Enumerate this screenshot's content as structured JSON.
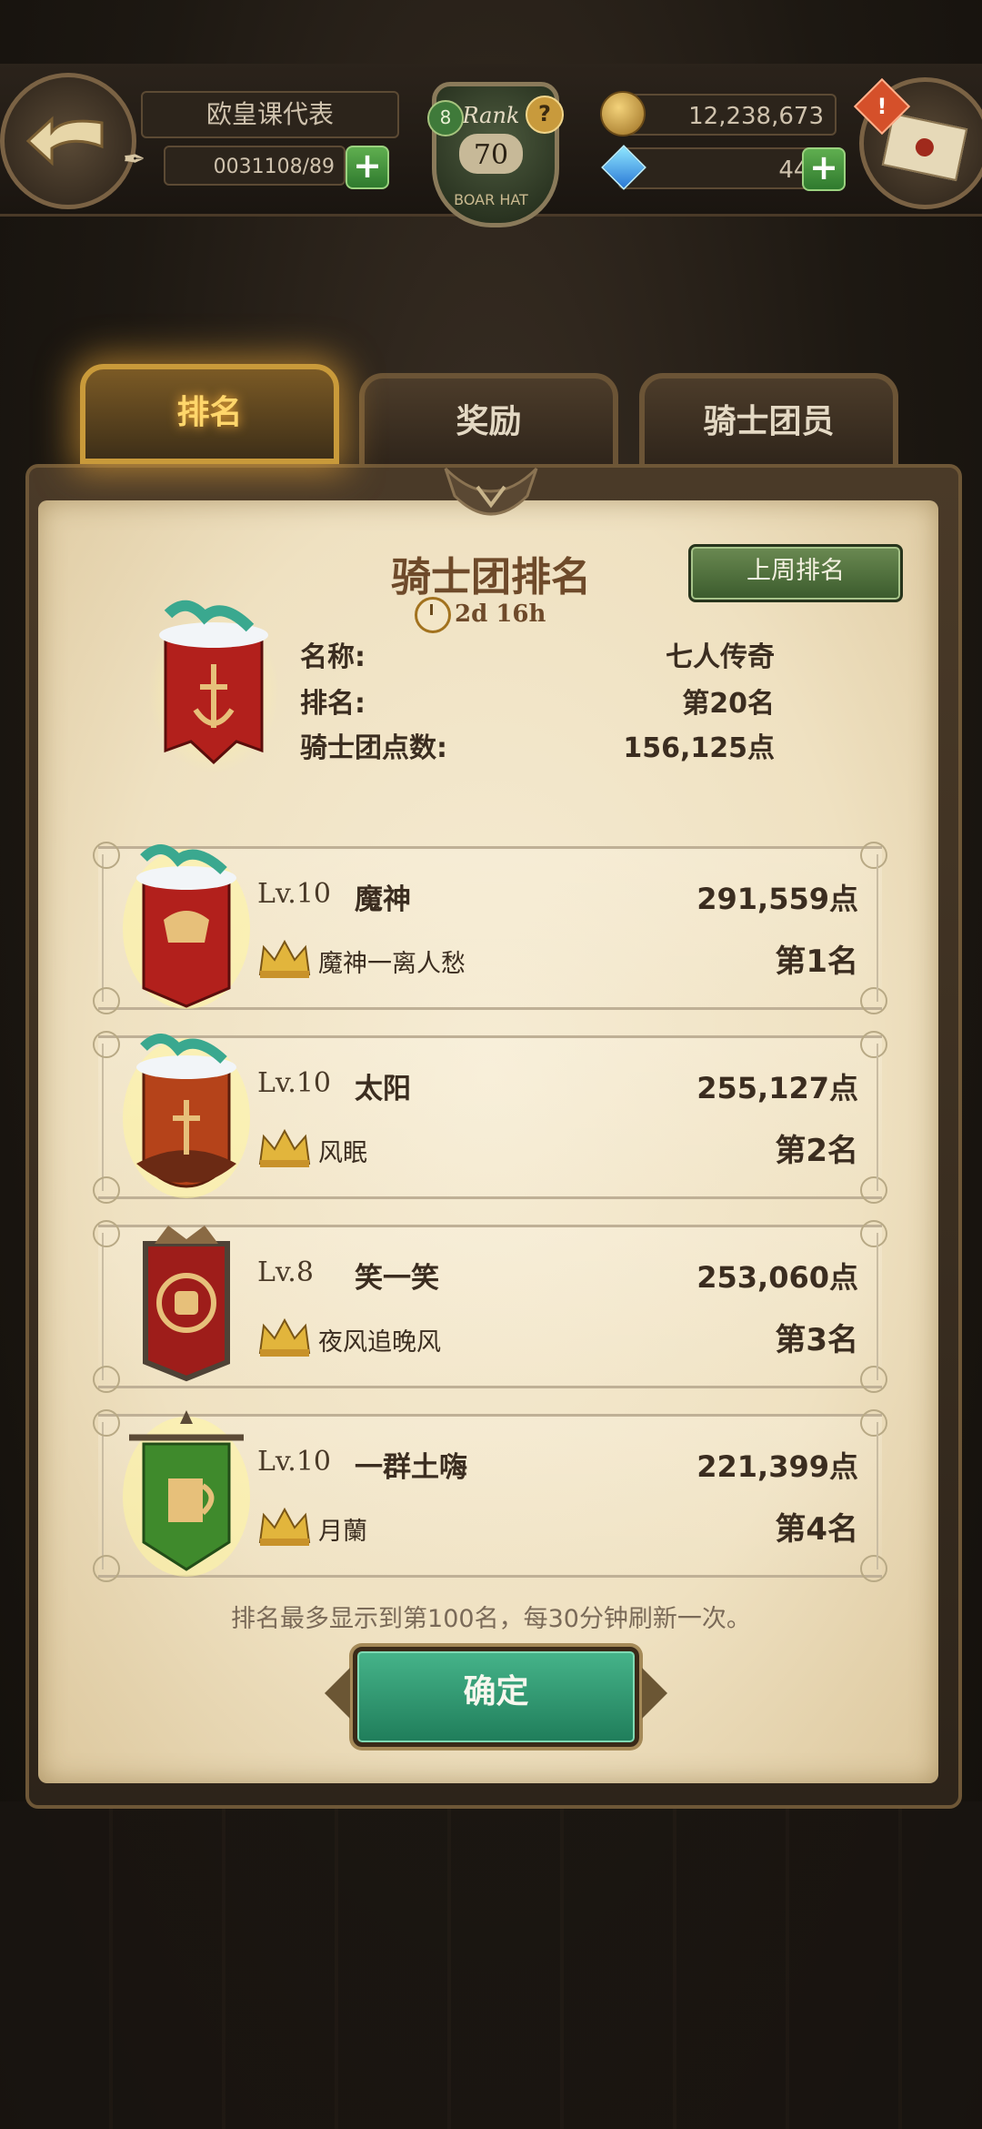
{
  "header": {
    "player_name": "欧皇课代表",
    "stamina": "0031108/89",
    "rank_label": "Rank",
    "rank_level": "70",
    "rank_badge": "8",
    "rank_subtitle": "BOAR HAT",
    "gold": "12,238,673",
    "gems": "444",
    "mail_alert": "!"
  },
  "tabs": [
    {
      "label": "排名",
      "active": true
    },
    {
      "label": "奖励",
      "active": false
    },
    {
      "label": "骑士团员",
      "active": false
    }
  ],
  "panel": {
    "title": "骑士团排名",
    "last_week_button": "上周排名",
    "timer": "2d 16h",
    "my_guild": {
      "name_label": "名称:",
      "name_value": "七人传奇",
      "rank_label": "排名:",
      "rank_value": "第20名",
      "points_label": "骑士团点数:",
      "points_value": "156,125点"
    },
    "rankings": [
      {
        "level": "Lv.10",
        "name": "魔神",
        "points": "291,559点",
        "leader": "魔神一离人愁",
        "place": "第1名",
        "banner": "red-dragon-banner"
      },
      {
        "level": "Lv.10",
        "name": "太阳",
        "points": "255,127点",
        "leader": "风眠",
        "place": "第2名",
        "banner": "orange-dragon-banner"
      },
      {
        "level": "Lv.8",
        "name": "笑一笑",
        "points": "253,060点",
        "leader": "夜风追晚风",
        "place": "第3名",
        "banner": "red-fist-banner"
      },
      {
        "level": "Lv.10",
        "name": "一群土嗨",
        "points": "221,399点",
        "leader": "月蘭",
        "place": "第4名",
        "banner": "green-mug-banner"
      }
    ],
    "note": "排名最多显示到第100名，每30分钟刷新一次。",
    "confirm_button": "确定"
  },
  "colors": {
    "parchment": "#efe1c1",
    "active_tab_glow": "#ffb23a",
    "confirm_green": "#2f9a70",
    "last_week_green": "#557a40"
  }
}
